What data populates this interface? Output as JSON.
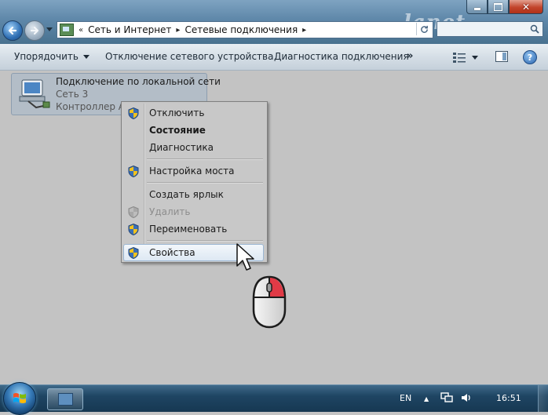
{
  "window": {
    "watermark": "lanet",
    "controls": {
      "minimize": "minimize",
      "maximize": "maximize",
      "close": "✕"
    }
  },
  "address": {
    "prefix": "«",
    "crumbs": [
      "Сеть и Интернет",
      "Сетевые подключения"
    ],
    "separator": "▸"
  },
  "toolbar": {
    "organize": "Упорядочить",
    "disable_device": "Отключение сетевого устройства",
    "diagnose": "Диагностика подключения",
    "more": "»",
    "help": "?"
  },
  "connection": {
    "name": "Подключение по локальной сети",
    "network": "Сеть  3",
    "device": "Контроллер Atheros"
  },
  "context_menu": {
    "items": [
      {
        "label": "Отключить",
        "shield": true,
        "state": "normal"
      },
      {
        "label": "Состояние",
        "shield": false,
        "state": "bold"
      },
      {
        "label": "Диагностика",
        "shield": false,
        "state": "normal"
      },
      {
        "label": "Настройка моста",
        "shield": true,
        "state": "normal"
      },
      {
        "label": "Создать ярлык",
        "shield": false,
        "state": "normal"
      },
      {
        "label": "Удалить",
        "shield": true,
        "state": "disabled"
      },
      {
        "label": "Переименовать",
        "shield": true,
        "state": "normal"
      },
      {
        "label": "Свойства",
        "shield": true,
        "state": "hover"
      }
    ]
  },
  "taskbar": {
    "language": "EN",
    "clock": "16:51",
    "tray_up": "▲"
  },
  "colors": {
    "accent": "#2f6fb4",
    "taskbar": "#1f4563",
    "menu_hover_border": "#9cb7d3",
    "mouse_button_highlight": "#e03a46"
  }
}
